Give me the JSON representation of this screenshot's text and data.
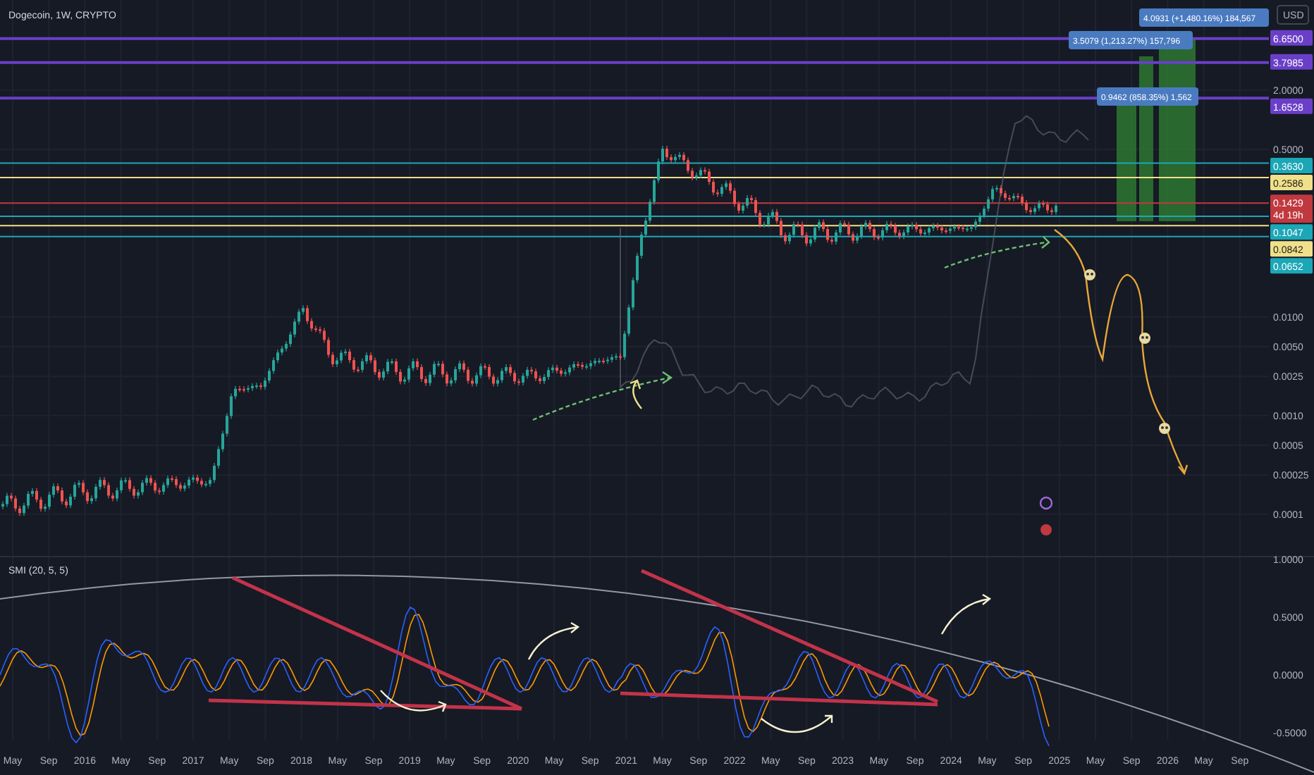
{
  "chart": {
    "title": "Dogecoin, 1W, CRYPTO",
    "currency": "USD",
    "measurements": [
      {
        "label": "4.0931 (+1,480.16%) 184,567"
      },
      {
        "label": "3.5079 (1,213.27%) 157,796"
      },
      {
        "label": "0.9462 (858.35%) 1,562"
      }
    ],
    "price_axis": [
      {
        "label": "6.6500",
        "kind": "tag",
        "color": "#6a3fc8"
      },
      {
        "label": "3.7985",
        "kind": "tag",
        "color": "#6a3fc8"
      },
      {
        "label": "2.0000",
        "kind": "tick"
      },
      {
        "label": "1.6528",
        "kind": "tag",
        "color": "#6a3fc8"
      },
      {
        "label": "0.5000",
        "kind": "tick"
      },
      {
        "label": "0.3630",
        "kind": "tag",
        "color": "#1ca7b6"
      },
      {
        "label": "0.2586",
        "kind": "tag",
        "color": "#f0e08a"
      },
      {
        "label": "0.1429",
        "kind": "tag",
        "color": "#c0393f",
        "sub": "4d 19h"
      },
      {
        "label": "0.1047",
        "kind": "tag",
        "color": "#1ca7b6"
      },
      {
        "label": "0.0842",
        "kind": "tag",
        "color": "#f0e08a"
      },
      {
        "label": "0.0652",
        "kind": "tag",
        "color": "#1ca7b6"
      },
      {
        "label": "0.0100",
        "kind": "tick"
      },
      {
        "label": "0.0050",
        "kind": "tick"
      },
      {
        "label": "0.0025",
        "kind": "tick"
      },
      {
        "label": "0.0010",
        "kind": "tick"
      },
      {
        "label": "0.0005",
        "kind": "tick"
      },
      {
        "label": "0.00025",
        "kind": "tick"
      },
      {
        "label": "0.0001",
        "kind": "tick"
      }
    ],
    "indicator": {
      "label": "SMI (20, 5, 5)",
      "axis": [
        "1.0000",
        "0.5000",
        "0.0000",
        "-0.5000"
      ]
    },
    "time_axis": [
      "May",
      "Sep",
      "2016",
      "May",
      "Sep",
      "2017",
      "May",
      "Sep",
      "2018",
      "May",
      "Sep",
      "2019",
      "May",
      "Sep",
      "2020",
      "May",
      "Sep",
      "2021",
      "May",
      "Sep",
      "2022",
      "May",
      "Sep",
      "2023",
      "May",
      "Sep",
      "2024",
      "May",
      "Sep",
      "2025",
      "May",
      "Sep",
      "2026",
      "May",
      "Sep"
    ]
  }
}
